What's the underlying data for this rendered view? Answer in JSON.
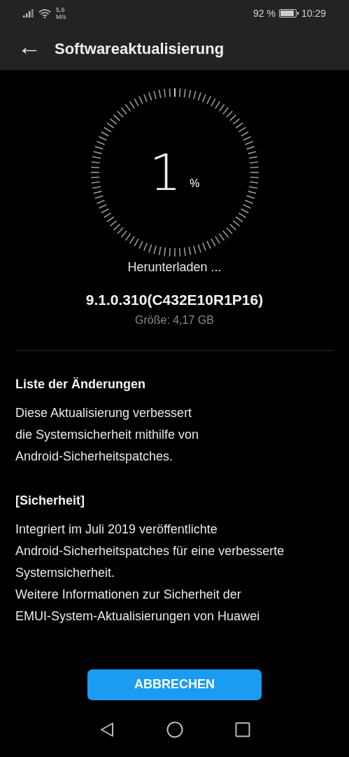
{
  "status_bar": {
    "speed_value": "5,6",
    "speed_unit": "M/s",
    "battery_percent": "92 %",
    "time": "10:29"
  },
  "header": {
    "back_icon": "←",
    "title": "Softwareaktualisierung"
  },
  "progress": {
    "value": "1",
    "unit": "%",
    "status": "Herunterladen ..."
  },
  "package": {
    "version": "9.1.0.310(C432E10R1P16)",
    "size": "Größe: 4,17 GB"
  },
  "changelog": [
    {
      "kind": "heading",
      "text": "Liste der Änderungen"
    },
    {
      "kind": "paragraph",
      "text": "Diese Aktualisierung verbessert\ndie Systemsicherheit mithilfe von\nAndroid-Sicherheitspatches."
    },
    {
      "kind": "heading",
      "text": "[Sicherheit]"
    },
    {
      "kind": "paragraph",
      "text": "Integriert im Juli 2019 veröffentlichte\nAndroid-Sicherheitspatches für eine verbesserte\nSystemsicherheit."
    },
    {
      "kind": "tight",
      "text": "Weitere Informationen zur Sicherheit der\nEMUI-System-Aktualisierungen von Huawei"
    }
  ],
  "cancel_button": "ABBRECHEN"
}
